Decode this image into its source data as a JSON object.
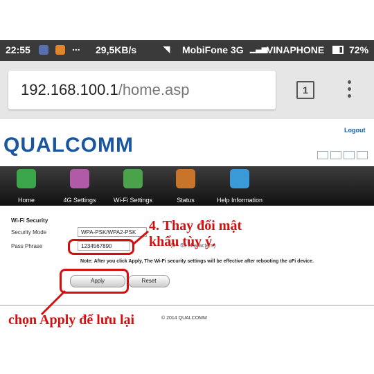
{
  "statusbar": {
    "time": "22:55",
    "dots": "...",
    "speed": "29,5KB/s",
    "carrier1": "MobiFone 3G",
    "carrier2": "VINAPHONE",
    "battery": "72%"
  },
  "browser": {
    "url_host": "192.168.100.1",
    "url_path": "/home.asp",
    "tab_count": "1"
  },
  "header": {
    "logo": "QUALCOMM",
    "logout": "Logout"
  },
  "nav": {
    "items": [
      {
        "label": "Home",
        "color": "#3aa54a"
      },
      {
        "label": "4G Settings",
        "color": "#b05aa8"
      },
      {
        "label": "Wi-Fi Settings",
        "color": "#4aa34a"
      },
      {
        "label": "Status",
        "color": "#c8742a"
      },
      {
        "label": "Help Information",
        "color": "#3a9ad8"
      }
    ]
  },
  "form": {
    "section_title": "Wi-Fi Security",
    "security_mode_label": "Security Mode",
    "security_mode_value": "WPA-PSK/WPA2-PSK",
    "pass_phrase_label": "Pass Phrase",
    "pass_phrase_value": "1234567890",
    "hint": "(8 - 63 characters)",
    "note": "Note: After you click Apply, The Wi-Fi security settings will be effective after rebooting the uFi device.",
    "apply_label": "Apply",
    "reset_label": "Reset"
  },
  "footer": {
    "copyright": "© 2014 QUALCOMM"
  },
  "annotations": {
    "step4_line1": "4. Thay đổi mật",
    "step4_line2": "khẩu tùy ý.",
    "apply_hint": "chọn Apply để lưu lại",
    "color": "#d40f0f"
  }
}
